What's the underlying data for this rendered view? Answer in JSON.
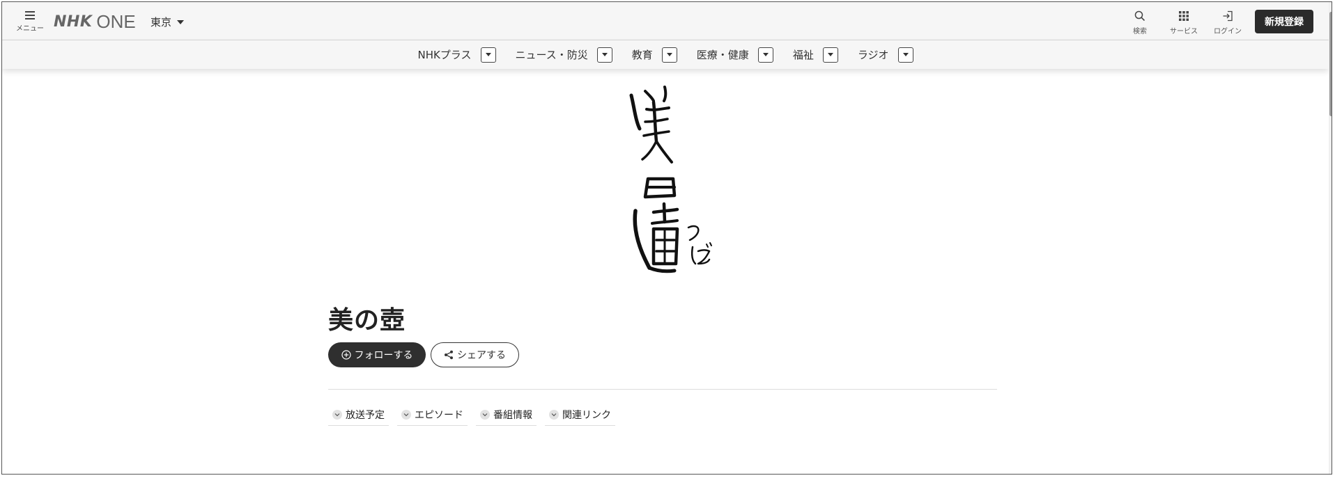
{
  "header": {
    "menu_label": "メニュー",
    "logo_nhk": "NHK",
    "logo_one": "ONE",
    "region": "東京",
    "search_label": "検索",
    "services_label": "サービス",
    "login_label": "ログイン",
    "signup_label": "新規登録"
  },
  "nav": {
    "items": [
      {
        "label": "NHKプラス"
      },
      {
        "label": "ニュース・防災"
      },
      {
        "label": "教育"
      },
      {
        "label": "医療・健康"
      },
      {
        "label": "福祉"
      },
      {
        "label": "ラジオ"
      }
    ]
  },
  "program": {
    "logo_text": "美の壺 つぼ",
    "title": "美の壺",
    "follow_label": "フォローする",
    "share_label": "シェアする"
  },
  "tabs": [
    {
      "label": "放送予定"
    },
    {
      "label": "エピソード"
    },
    {
      "label": "番組情報"
    },
    {
      "label": "関連リンク"
    }
  ]
}
